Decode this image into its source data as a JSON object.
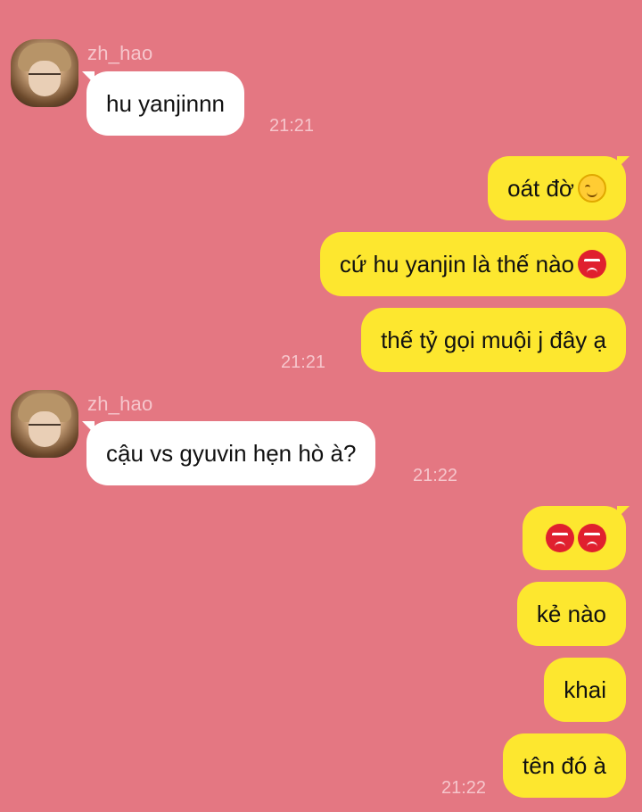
{
  "app": {
    "background": "#e47782",
    "incoming_color": "#ffffff",
    "outgoing_color": "#fde72f"
  },
  "messages": [
    {
      "direction": "in",
      "sender": "zh_hao",
      "text": "hu yanjinnn",
      "time": "21:21"
    },
    {
      "direction": "out",
      "text": "oát đờ",
      "emoji": [
        "smiling-face-icon"
      ]
    },
    {
      "direction": "out",
      "text": "cứ hu yanjin là thế nào ",
      "emoji": [
        "angry-face-icon"
      ]
    },
    {
      "direction": "out",
      "text": "thế tỷ gọi muội j đây ạ",
      "time": "21:21"
    },
    {
      "direction": "in",
      "sender": "zh_hao",
      "text": "cậu vs gyuvin hẹn hò à?",
      "time": "21:22"
    },
    {
      "direction": "out",
      "text": "",
      "emoji": [
        "angry-face-icon",
        "angry-face-icon"
      ]
    },
    {
      "direction": "out",
      "text": "kẻ nào"
    },
    {
      "direction": "out",
      "text": "khai"
    },
    {
      "direction": "out",
      "text": "tên đó à",
      "time": "21:22"
    }
  ]
}
